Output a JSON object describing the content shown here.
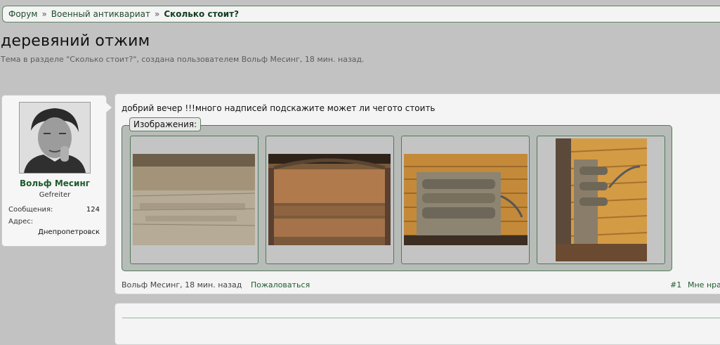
{
  "breadcrumb": {
    "items": [
      "Форум",
      "Военный антиквариат"
    ],
    "current": "Сколько стоит?",
    "separator": "»"
  },
  "thread": {
    "title": "деревяний отжим",
    "description": "Тема в разделе \"Сколько стоит?\", создана пользователем Вольф Месинг, 18 мин. назад."
  },
  "user": {
    "name": "Вольф Месинг",
    "title": "Gefreiter",
    "messages_label": "Сообщения:",
    "messages_count": "124",
    "address_label": "Адрес:",
    "address_value": "Днепропетровск"
  },
  "post": {
    "text": "добрий вечер !!!много надписей подскажите может ли чегото стоить",
    "attachments_label": "Изображения:",
    "author": "Вольф Месинг, 18 мин. назад",
    "report": "Пожаловаться",
    "number": "#1",
    "like": "Мне нра"
  },
  "colors": {
    "accent": "#1e5b2d",
    "border_green": "#4f7a57",
    "background": "#c2c2c2"
  }
}
